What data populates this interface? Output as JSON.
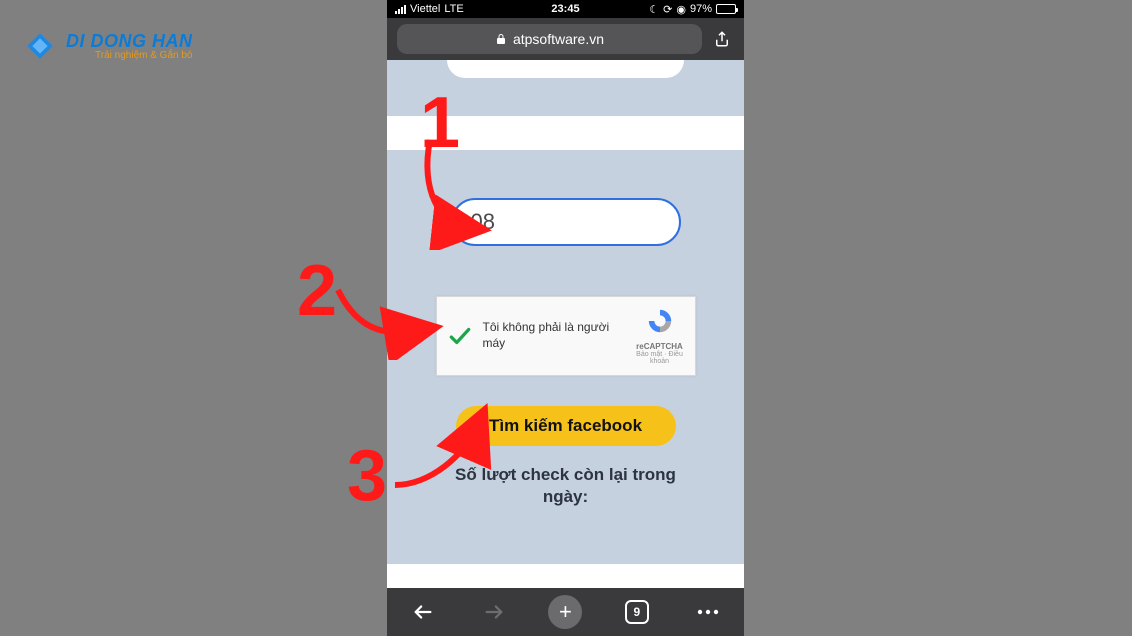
{
  "watermark": {
    "title": "DI DONG HAN",
    "subtitle": "Trải nghiệm & Gắn bó"
  },
  "status": {
    "carrier": "Viettel",
    "network": "LTE",
    "time": "23:45",
    "battery_pct": "97%"
  },
  "browser": {
    "url": "atpsoftware.vn",
    "tab_count": "9"
  },
  "form": {
    "phone_value": "08",
    "recaptcha_label": "Tôi không phải là người máy",
    "recaptcha_brand": "reCAPTCHA",
    "recaptcha_links": "Bảo mật · Điều khoản",
    "search_button": "Tìm kiếm facebook",
    "remaining_label": "Số lượt check còn lại trong ngày:"
  },
  "annotations": {
    "step1": "1",
    "step2": "2",
    "step3": "3"
  }
}
